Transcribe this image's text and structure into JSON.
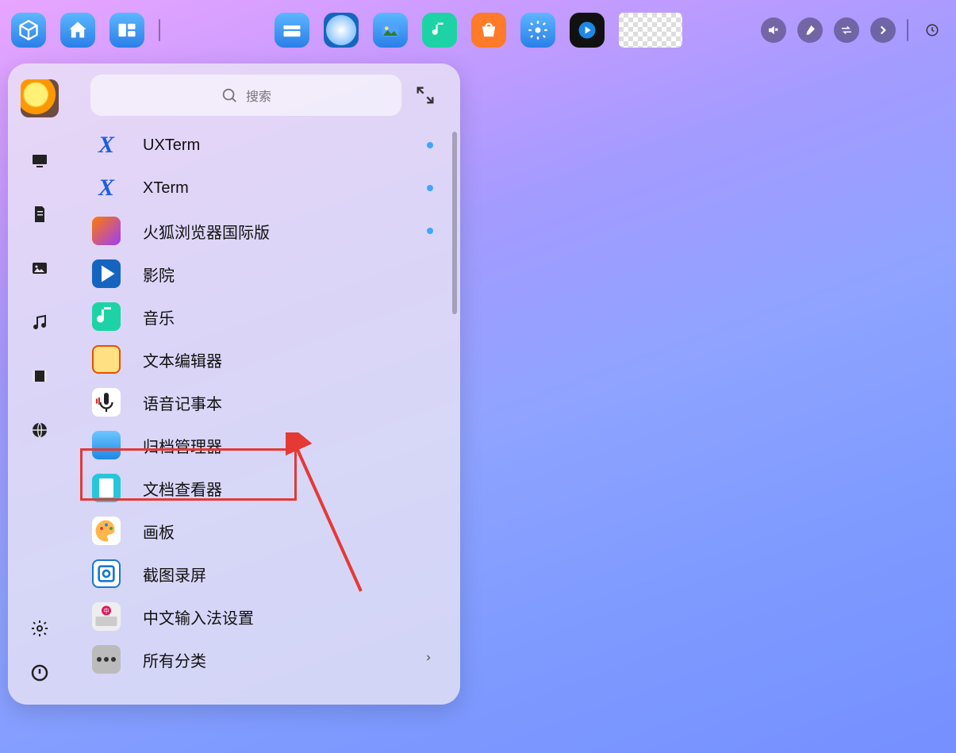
{
  "taskbar": {
    "left_icons": [
      "launcher-cube-icon",
      "home-icon",
      "workspace-icon"
    ],
    "center_icons": [
      "files-icon",
      "browser-icon",
      "photos-icon",
      "music-player-icon",
      "app-store-icon",
      "settings-icon",
      "video-player-icon"
    ],
    "right_icons": [
      "volume-mute-icon",
      "brush-icon",
      "transfer-icon",
      "chevron-right-icon"
    ]
  },
  "search": {
    "placeholder": "搜索"
  },
  "sidebar_categories": [
    "computer",
    "document",
    "image",
    "music",
    "video",
    "globe"
  ],
  "apps": [
    {
      "id": "uxterm",
      "label": "UXTerm",
      "icon": "terminal-x-icon",
      "dot": true
    },
    {
      "id": "xterm",
      "label": "XTerm",
      "icon": "terminal-x-icon",
      "dot": true
    },
    {
      "id": "firefox",
      "label": "火狐浏览器国际版",
      "icon": "firefox-icon",
      "dot": true
    },
    {
      "id": "theater",
      "label": "影院",
      "icon": "play-icon",
      "dot": false
    },
    {
      "id": "music",
      "label": "音乐",
      "icon": "music-note-icon",
      "dot": false
    },
    {
      "id": "editor",
      "label": "文本编辑器",
      "icon": "text-editor-icon",
      "dot": false
    },
    {
      "id": "voicenote",
      "label": "语音记事本",
      "icon": "microphone-icon",
      "dot": false
    },
    {
      "id": "archive",
      "label": "归档管理器",
      "icon": "archive-icon",
      "dot": false
    },
    {
      "id": "docview",
      "label": "文档查看器",
      "icon": "document-viewer-icon",
      "dot": false
    },
    {
      "id": "draw",
      "label": "画板",
      "icon": "palette-icon",
      "dot": false
    },
    {
      "id": "capture",
      "label": "截图录屏",
      "icon": "screenshot-icon",
      "dot": false
    },
    {
      "id": "ime",
      "label": "中文输入法设置",
      "icon": "keyboard-ime-icon",
      "dot": false
    }
  ],
  "all_categories_label": "所有分类",
  "annotation": {
    "highlighted_app_index": 6
  }
}
